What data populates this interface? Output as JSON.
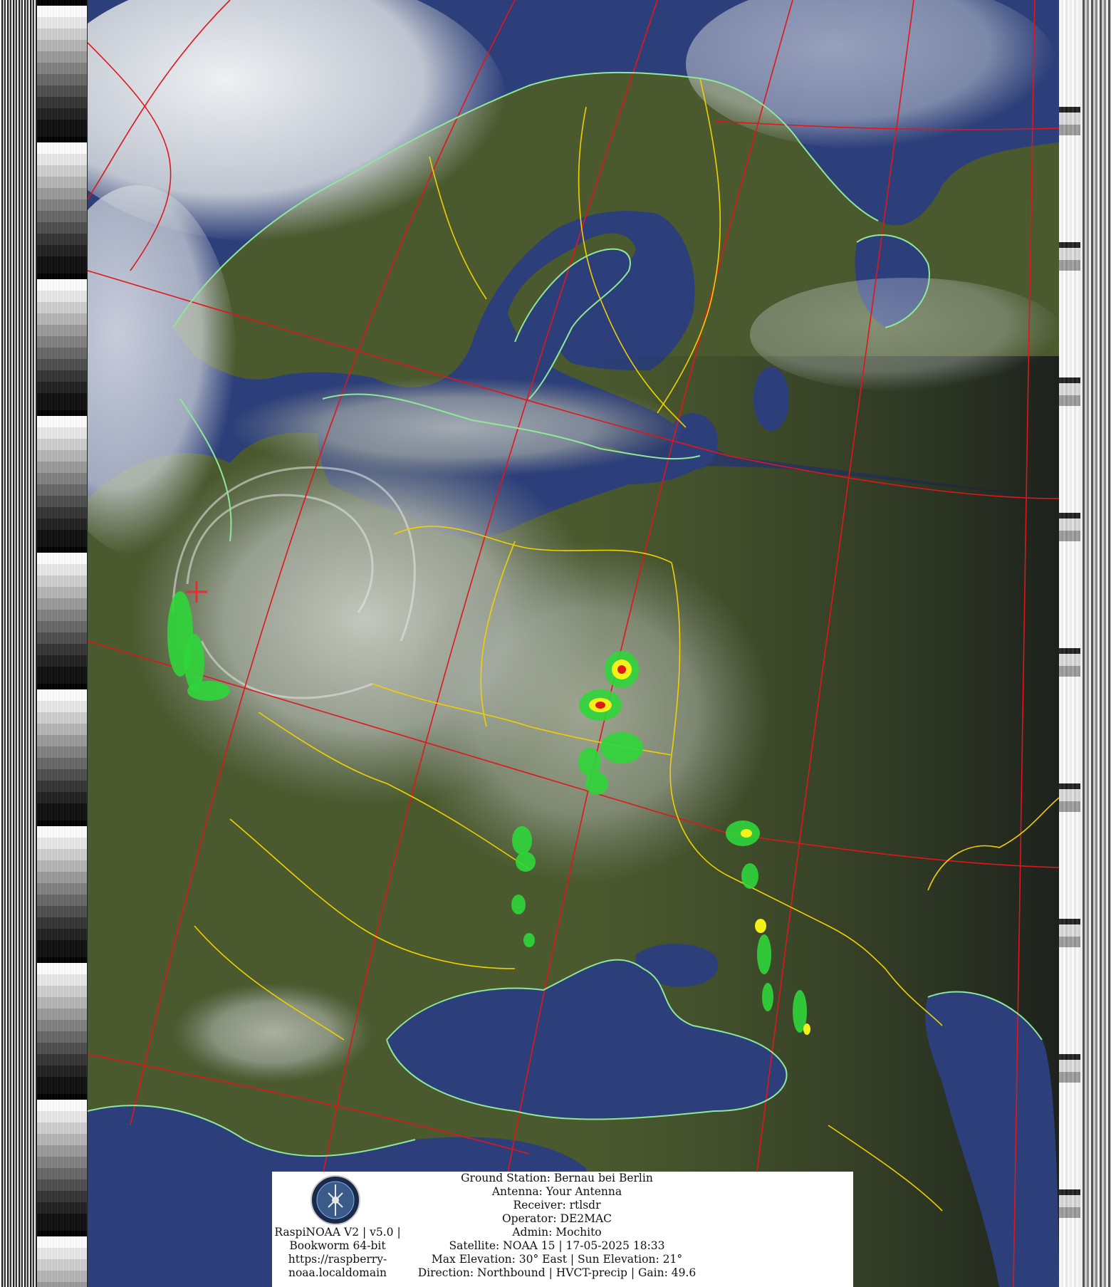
{
  "image": {
    "subject": "satellite-weather-image",
    "colors": {
      "sea": "#2d3f7a",
      "land": "#4a5a2e",
      "cloud": "#d8dde2",
      "grid_lines": "#e0161b",
      "borders": "#f0d000",
      "coastlines": "#8fe89a",
      "precip_light": "#2fd63a",
      "precip_mid": "#f2f21a",
      "precip_heavy": "#e01818",
      "station_marker": "#e03030"
    }
  },
  "info_box": {
    "software_lines": [
      "RaspiNOAA V2 | v5.0 |",
      "Bookworm 64-bit",
      "https://raspberry-",
      "noaa.localdomain"
    ],
    "station_lines": [
      "Ground Station: Bernau bei Berlin",
      "Antenna: Your Antenna",
      "Receiver: rtlsdr",
      "Operator: DE2MAC",
      "Admin: Mochito",
      "Satellite: NOAA 15 | 17-05-2025 18:33",
      "Max Elevation: 30° East | Sun Elevation: 21°",
      "Direction: Northbound | HVCT-precip | Gain: 49.6"
    ]
  }
}
